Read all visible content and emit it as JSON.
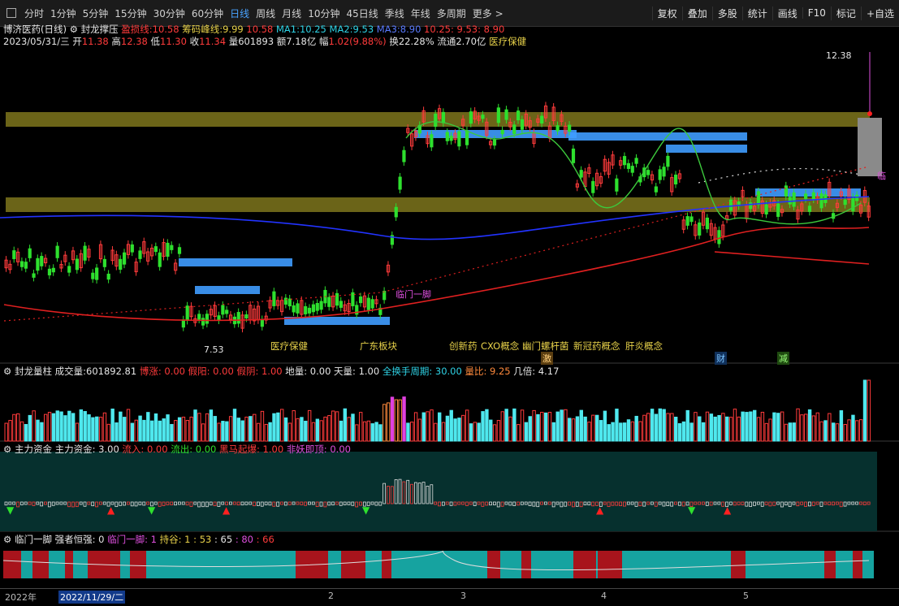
{
  "toolbar": {
    "periods": [
      "分时",
      "1分钟",
      "5分钟",
      "15分钟",
      "30分钟",
      "60分钟",
      "日线",
      "周线",
      "月线",
      "10分钟",
      "45日线",
      "季线",
      "年线",
      "多周期",
      "更多"
    ],
    "active_period": "日线",
    "right_buttons": [
      "复权",
      "叠加",
      "多股",
      "统计",
      "画线",
      "F10",
      "标记",
      "+自选"
    ]
  },
  "header": {
    "stock_name": "博济医药(日线)",
    "indicator_name": "封龙撑压",
    "pressure_label": "盈损线:",
    "pressure_value": "10.58",
    "chip_label": "筹码峰线:",
    "chip_value": "9.99",
    "v3": "10.58",
    "ma1_label": "MA1:",
    "ma1_value": "10.25",
    "ma2_label": "MA2:",
    "ma2_value": "9.53",
    "ma3_label": "MA3:",
    "ma3_value": "8.90",
    "v4": "10.25",
    "v5": "9.53",
    "v6": "8.90",
    "date": "2023/05/31/三",
    "open_label": "开",
    "open": "11.38",
    "high_label": "高",
    "high": "12.38",
    "low_label": "低",
    "low": "11.30",
    "close_label": "收",
    "close": "11.34",
    "vol_label": "量",
    "vol": "601893",
    "amt_label": "额",
    "amt": "7.18亿",
    "chg_label": "幅",
    "chg": "1.02(9.88%)",
    "turn_label": "换",
    "turn": "22.28%",
    "float_label": "流通",
    "float": "2.70亿",
    "sector": "医疗保健"
  },
  "main_chart": {
    "high_mark": "12.38",
    "low_mark": "7.53",
    "signal": "临门一脚",
    "right_signal": "临",
    "concepts": [
      "医疗保健",
      "广东板块",
      "创新药",
      "CXO概念",
      "幽门螺杆菌",
      "新冠药概念",
      "肝炎概念"
    ],
    "tags": [
      "激",
      "财",
      "减"
    ]
  },
  "panel2": {
    "title": "封龙量柱",
    "vol_label": "成交量:",
    "vol": "601892.81",
    "t1": "博涨: 0.00",
    "t2": "假阳: 0.00",
    "t3": "假阴: 1.00",
    "t4": "地量: 0.00",
    "t5": "天量: 1.00",
    "t6": "全换手周期: 30.00",
    "t7": "量比: 9.25",
    "t8": "几倍: 4.17"
  },
  "panel3": {
    "title": "主力资金",
    "main_label": "主力资金: 3.00",
    "in": "流入: 0.00",
    "out": "流出: 0.00",
    "horse": "黑马起爆: 1.00",
    "top": "非妖即顶: 0.00"
  },
  "panel4": {
    "title": "临门一脚",
    "strong": "强者恒强: 0",
    "lmyj": "临门一脚: 1",
    "hold": "持谷: 1",
    "v1": ": 53",
    "v2": ": 65",
    "v3": ": 80",
    "v4": ": 66"
  },
  "axis": {
    "labels": [
      "2022年",
      "2022/11/29/二",
      "2",
      "3",
      "4",
      "5"
    ]
  },
  "colors": {
    "up": "#ff3b3b",
    "down": "#2ee02e",
    "band": "#6b6418",
    "chip": "#3f9cff",
    "bg": "#000000"
  }
}
